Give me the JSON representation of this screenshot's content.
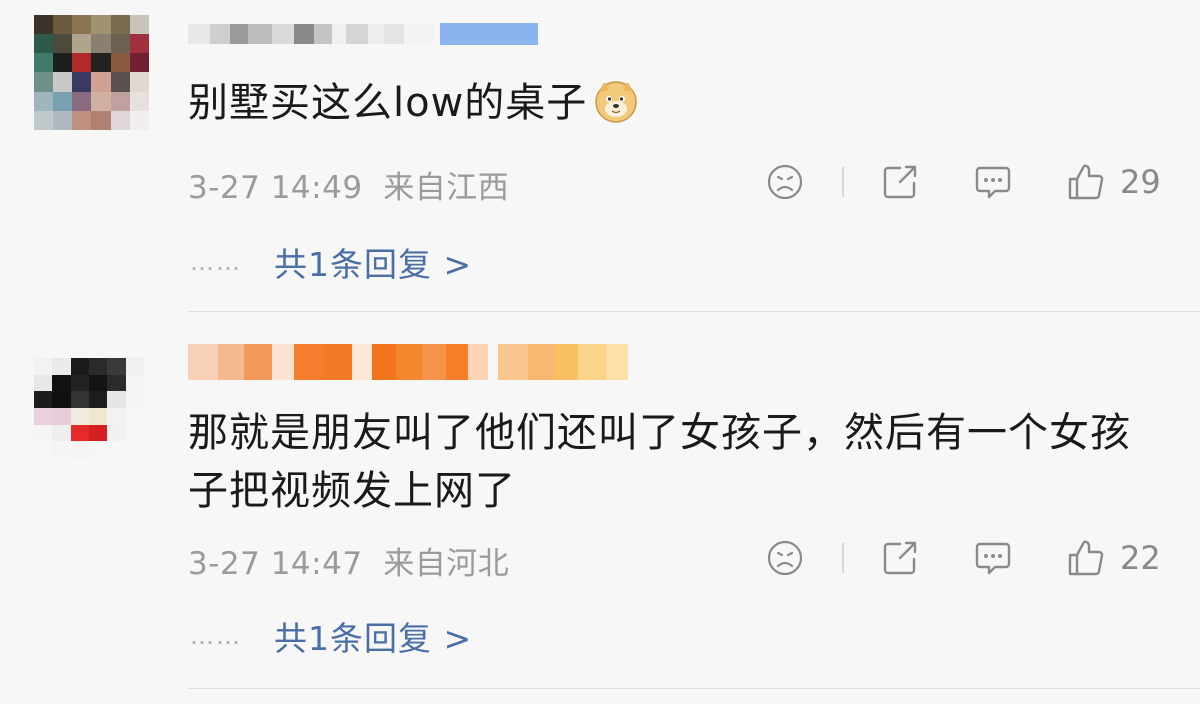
{
  "comments": [
    {
      "content": "别墅买这么low的桌子",
      "emoji": "doge-emoji",
      "time": "3-27 14:49",
      "location": "来自江西",
      "like_count": "29",
      "reply_link": "共1条回复 >",
      "dots": "……"
    },
    {
      "content": "那就是朋友叫了他们还叫了女孩子，然后有一个女孩子把视频发上网了",
      "time": "3-27 14:47",
      "location": "来自河北",
      "like_count": "22",
      "reply_link": "共1条回复 >",
      "dots": "……"
    }
  ],
  "icons": {
    "dislike": "sad-face-icon",
    "share": "share-icon",
    "comment": "comment-icon",
    "like": "thumbs-up-icon"
  },
  "colors": {
    "link": "#4a6fa5",
    "meta": "#9b9b9b",
    "background": "#f7f7f7"
  }
}
